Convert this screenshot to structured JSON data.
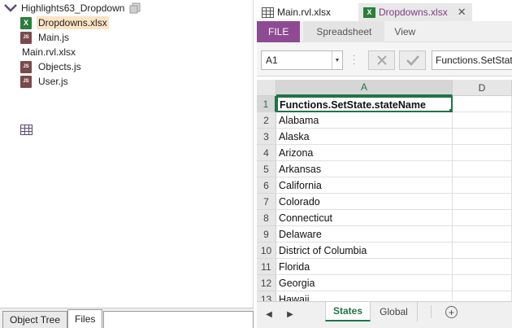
{
  "project": {
    "name": "Highlights63_Dropdown",
    "files": [
      {
        "label": "Dropdowns.xlsx",
        "type": "xlsx",
        "selected": true
      },
      {
        "label": "Main.js",
        "type": "js",
        "selected": false
      },
      {
        "label": "Main.rvl.xlsx",
        "type": "rvl",
        "selected": false
      },
      {
        "label": "Objects.js",
        "type": "js",
        "selected": false
      },
      {
        "label": "User.js",
        "type": "js",
        "selected": false
      }
    ]
  },
  "bottom_tabs": [
    "Object Tree",
    "Files"
  ],
  "doc_tabs": [
    {
      "label": "Main.rvl.xlsx",
      "active": false
    },
    {
      "label": "Dropdowns.xlsx",
      "active": true
    }
  ],
  "ribbon": {
    "file": "FILE",
    "tabs": [
      "Spreadsheet",
      "View"
    ]
  },
  "formula_bar": {
    "cell_ref": "A1",
    "value": "Functions.SetState.stateName"
  },
  "grid": {
    "columns": [
      "A",
      "D"
    ],
    "rows": [
      {
        "num": "1",
        "value": "Functions.SetState.stateName"
      },
      {
        "num": "2",
        "value": "Alabama"
      },
      {
        "num": "3",
        "value": "Alaska"
      },
      {
        "num": "4",
        "value": "Arizona"
      },
      {
        "num": "5",
        "value": "Arkansas"
      },
      {
        "num": "6",
        "value": "California"
      },
      {
        "num": "7",
        "value": "Colorado"
      },
      {
        "num": "8",
        "value": "Connecticut"
      },
      {
        "num": "9",
        "value": "Delaware"
      },
      {
        "num": "10",
        "value": "District of Columbia"
      },
      {
        "num": "11",
        "value": "Florida"
      },
      {
        "num": "12",
        "value": "Georgia"
      },
      {
        "num": "13",
        "value": "Hawaii"
      }
    ]
  },
  "sheets": [
    {
      "label": "States",
      "active": true
    },
    {
      "label": "Global",
      "active": false
    }
  ],
  "colors": {
    "accent": "#217346",
    "file_tab": "#8e4a93",
    "active_doc_tab_text": "#7d3c86",
    "selected_file_bg": "#fce4c4"
  }
}
